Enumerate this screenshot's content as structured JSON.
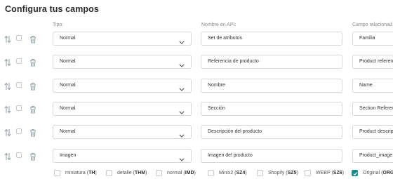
{
  "page_title": "Configura tus campos",
  "columns": {
    "tipo": "Tipo:",
    "api": "Nombre en API:",
    "relacion": "Campo relacionad"
  },
  "rows": [
    {
      "tipo": "Normal",
      "api": "Set de atributos",
      "relacion": "Familia"
    },
    {
      "tipo": "Normal",
      "api": "Referencia de producto",
      "relacion": "Product referenc"
    },
    {
      "tipo": "Normal",
      "api": "Nombre",
      "relacion": "Name"
    },
    {
      "tipo": "Normal",
      "api": "Sección",
      "relacion": "Section Referenc"
    },
    {
      "tipo": "Normal",
      "api": "Descripción del producto",
      "relacion": "Product descript"
    },
    {
      "tipo": "Imagen",
      "api": "Imagen del producto",
      "relacion": "Product_image"
    }
  ],
  "thumbnails": [
    {
      "name": "miniatura",
      "code": "TH",
      "checked": false
    },
    {
      "name": "detalle",
      "code": "THM",
      "checked": false
    },
    {
      "name": "normal",
      "code": "IMD",
      "checked": false
    },
    {
      "name": "Minix2",
      "code": "SZ4",
      "checked": false
    },
    {
      "name": "Shopify",
      "code": "SZ5",
      "checked": false
    },
    {
      "name": "WEBP",
      "code": "SZ6",
      "checked": false
    },
    {
      "name": "Original",
      "code": "ORG",
      "checked": true
    }
  ],
  "colors": {
    "accent": "#1e8a8a",
    "border": "#d8d8d8",
    "muted": "#8a8a8a"
  },
  "icons": {
    "sort": "sort-arrows-icon",
    "delete": "trash-icon",
    "dropdown": "chevron-down-icon"
  }
}
